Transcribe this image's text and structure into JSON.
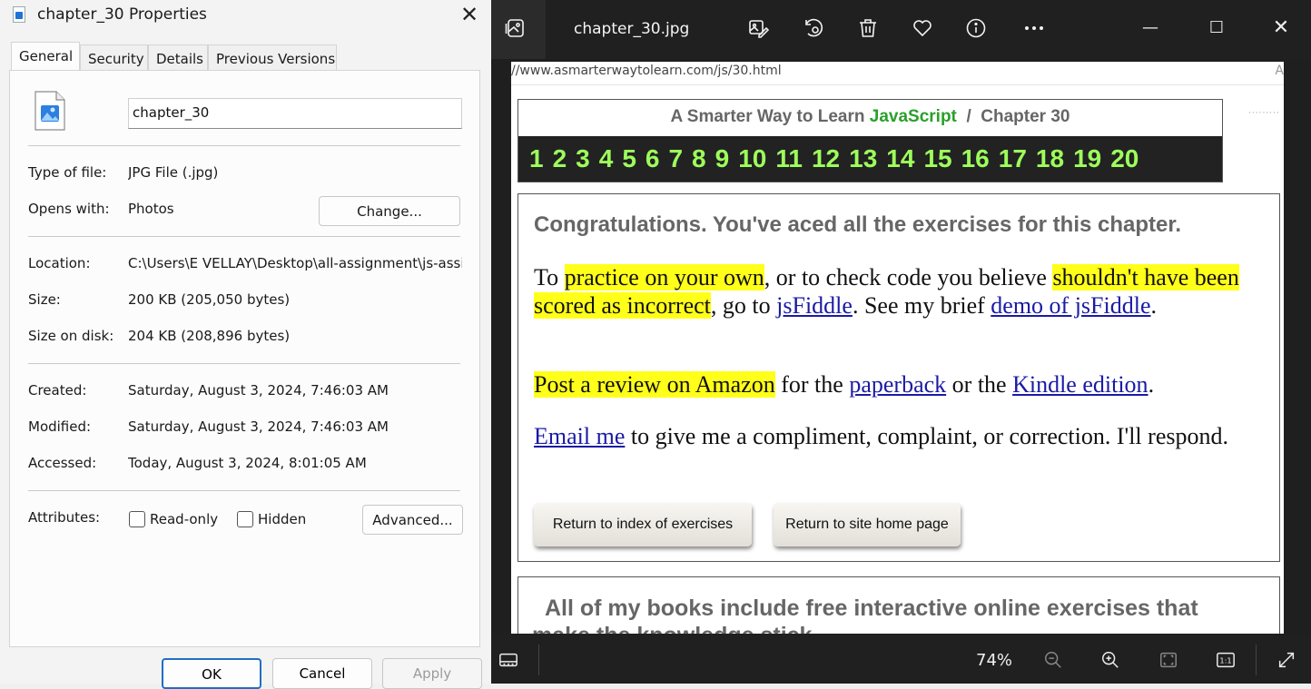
{
  "dialog": {
    "title": "chapter_30 Properties",
    "tabs": [
      "General",
      "Security",
      "Details",
      "Previous Versions"
    ],
    "filename": "chapter_30",
    "rows": {
      "type_label": "Type of file:",
      "type_value": "JPG File (.jpg)",
      "opens_label": "Opens with:",
      "opens_value": "Photos",
      "change_button": "Change...",
      "location_label": "Location:",
      "location_value": "C:\\Users\\E VELLAY\\Desktop\\all-assignment\\js-assig",
      "size_label": "Size:",
      "size_value": "200 KB (205,050 bytes)",
      "size_disk_label": "Size on disk:",
      "size_disk_value": "204 KB (208,896 bytes)",
      "created_label": "Created:",
      "created_value": "Saturday, August 3, 2024, 7:46:03 AM",
      "modified_label": "Modified:",
      "modified_value": "Saturday, August 3, 2024, 7:46:03 AM",
      "accessed_label": "Accessed:",
      "accessed_value": "Today, August 3, 2024, 8:01:05 AM",
      "attributes_label": "Attributes:",
      "readonly_label": "Read-only",
      "hidden_label": "Hidden",
      "advanced_button": "Advanced..."
    },
    "footer": {
      "ok": "OK",
      "cancel": "Cancel",
      "apply": "Apply"
    }
  },
  "viewer": {
    "filename": "chapter_30.jpg",
    "zoom": "74%",
    "icons": [
      "gallery-icon",
      "edit-image-icon",
      "rotate-icon",
      "delete-icon",
      "favorite-icon",
      "info-icon",
      "more-icon",
      "minimize-icon",
      "maximize-icon",
      "close-icon",
      "filmstrip-icon",
      "zoom-out-icon",
      "zoom-in-icon",
      "fit-icon",
      "actual-size-icon",
      "fullscreen-icon"
    ]
  },
  "image": {
    "url": "//www.asmarterwaytolearn.com/js/30.html",
    "url_right": "A",
    "header_pre": "A Smarter Way to Learn ",
    "header_js": "JavaScript",
    "header_post": "  /  Chapter 30",
    "chapters": [
      "1",
      "2",
      "3",
      "4",
      "5",
      "6",
      "7",
      "8",
      "9",
      "10",
      "11",
      "12",
      "13",
      "14",
      "15",
      "16",
      "17",
      "18",
      "19",
      "20"
    ],
    "congrats": "Congratulations. You've aced all the exercises for this chapter.",
    "p1": {
      "a": "To ",
      "hl1": "practice on your own",
      "b": ", or to check code you believe ",
      "hl2": "shouldn't have been scored as incorrect",
      "c": ", go to ",
      "link1": "jsFiddle",
      "d": ". See my brief ",
      "link2": "demo of jsFiddle",
      "e": "."
    },
    "p2": {
      "hl": "Post a review on Amazon",
      "a": " for the ",
      "link1": "paperback",
      "b": " or the ",
      "link2": "Kindle edition",
      "c": "."
    },
    "p3": {
      "link": "Email me",
      "a": " to give me a compliment, complaint, or correction. I'll respond."
    },
    "btn_index": "Return to index of exercises",
    "btn_home": "Return to site home page",
    "books_line1": "All of my books include free interactive online exercises that",
    "books_line2": "make the knowledge stick"
  }
}
